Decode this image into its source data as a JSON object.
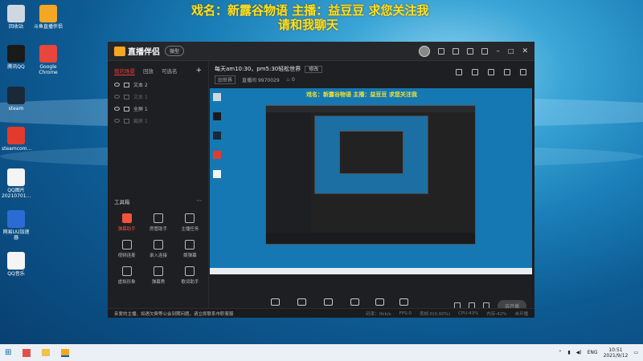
{
  "overlay": {
    "line1": "戏名：新露谷物语  主播：益豆豆  求您关注我",
    "line2": "请和我聊天"
  },
  "desktop_icons": [
    {
      "label": "回收站",
      "color": "#cfd8e0"
    },
    {
      "label": "斗鱼直播伴侣",
      "color": "#f5a623"
    },
    {
      "label": "腾讯QQ",
      "color": "#1a1a1a"
    },
    {
      "label": "Google Chrome",
      "color": "#e8453c"
    },
    {
      "label": "steam",
      "color": "#1b2838"
    },
    {
      "label": "steamcom...",
      "color": "#e23b2e"
    },
    {
      "label": "QQ图片 20210701...",
      "color": "#f4f4f4"
    },
    {
      "label": "网易UU加速器",
      "color": "#2b6cd4"
    },
    {
      "label": "QQ音乐",
      "color": "#f4f4f4"
    }
  ],
  "window": {
    "app_name": "直播伴侣",
    "version_label": "微型",
    "tabs": [
      "我的场景",
      "回放",
      "可选名"
    ],
    "scenes": [
      {
        "label": "文本 2",
        "enabled": true
      },
      {
        "label": "文本 1",
        "enabled": false
      },
      {
        "label": "全屏 1",
        "enabled": true
      },
      {
        "label": "截屏 1",
        "enabled": false
      }
    ],
    "toolbox_title": "工具箱",
    "tools": [
      {
        "label": "弹幕助手",
        "active": true
      },
      {
        "label": "房管助手",
        "active": false
      },
      {
        "label": "主播任务",
        "active": false
      },
      {
        "label": "视频连麦",
        "active": false
      },
      {
        "label": "录入连接",
        "active": false
      },
      {
        "label": "娱弹幕",
        "active": false
      },
      {
        "label": "虚拟形象",
        "active": false
      },
      {
        "label": "弹幕秀",
        "active": false
      },
      {
        "label": "歌词助手",
        "active": false
      }
    ],
    "stream_title": "每天am10:30，pm5:30轻松世界",
    "edit_label": "修改",
    "category": "旧世界",
    "room_label": "直播间",
    "room_id": "9970029",
    "heat": "0",
    "preview_overlay": "戏名：新露谷物语  主播：益豆豆  求您关注我",
    "bottom_buttons": [
      "直播屏幕",
      "摄像头",
      "手机投屏",
      "多媒体",
      "麦克风",
      "扬声器"
    ],
    "live_button": "去开播",
    "status": {
      "notice": "亲爱的主播，如遇欠费等公会到期问题，请立即联系市职客服",
      "bitrate": "码率：0kb/s",
      "fps": "FPS:0",
      "drop": "丢帧:0(0.00%)",
      "cpu": "CPU:43%",
      "mem": "内存:42%",
      "open": "未开播"
    }
  },
  "taskbar": {
    "lang": "ENG",
    "time": "10:51",
    "date": "2021/9/12"
  }
}
